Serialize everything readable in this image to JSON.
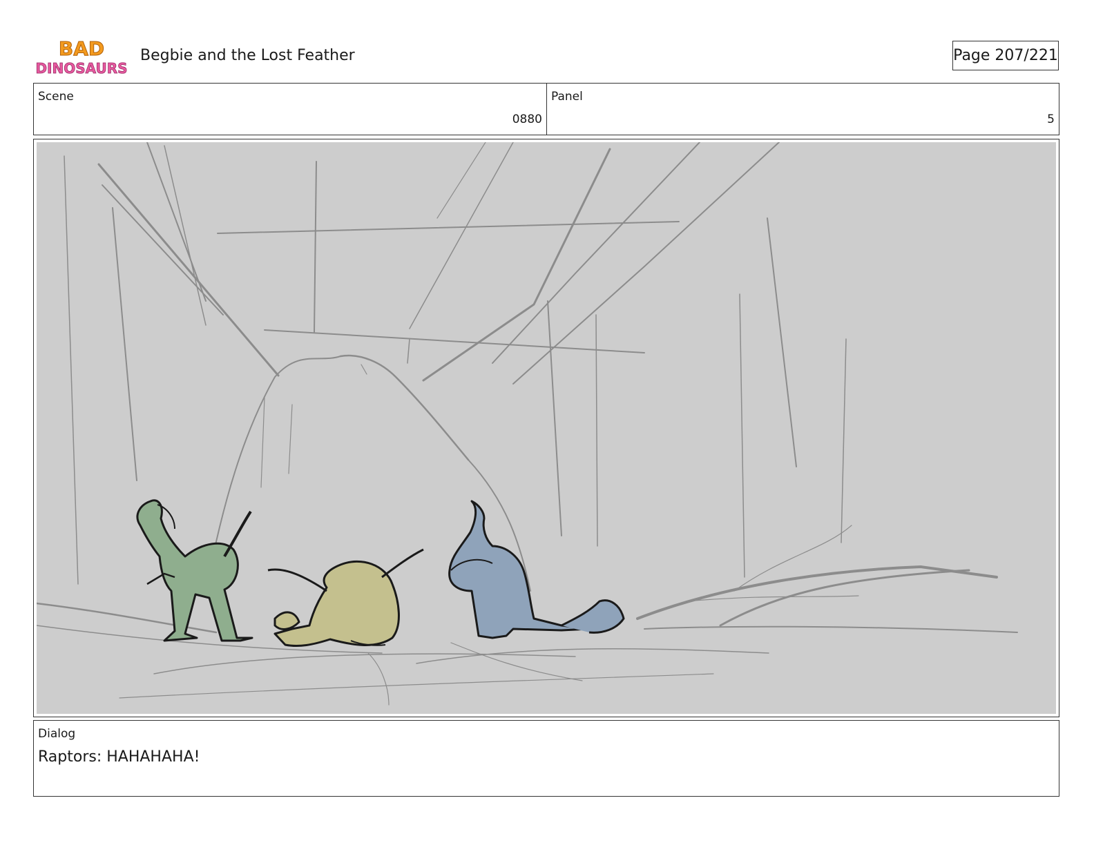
{
  "header": {
    "logo": {
      "line1": "BAD",
      "line2": "DINOSAURS"
    },
    "title": "Begbie and the Lost Feather",
    "page_label": "Page 207/221"
  },
  "scene": {
    "label": "Scene",
    "value": "0880"
  },
  "panel": {
    "label": "Panel",
    "value": "5"
  },
  "dialog": {
    "label": "Dialog",
    "text": "Raptors: HAHAHAHA!"
  },
  "colors": {
    "background": "#cdcdcd",
    "sketch_line": "#8c8c8c",
    "dino_green": "#8fae8e",
    "dino_yellow": "#c4c08e",
    "dino_blue": "#8fa3ba",
    "logo_orange": "#f39a1e",
    "logo_pink": "#e85aa0"
  }
}
